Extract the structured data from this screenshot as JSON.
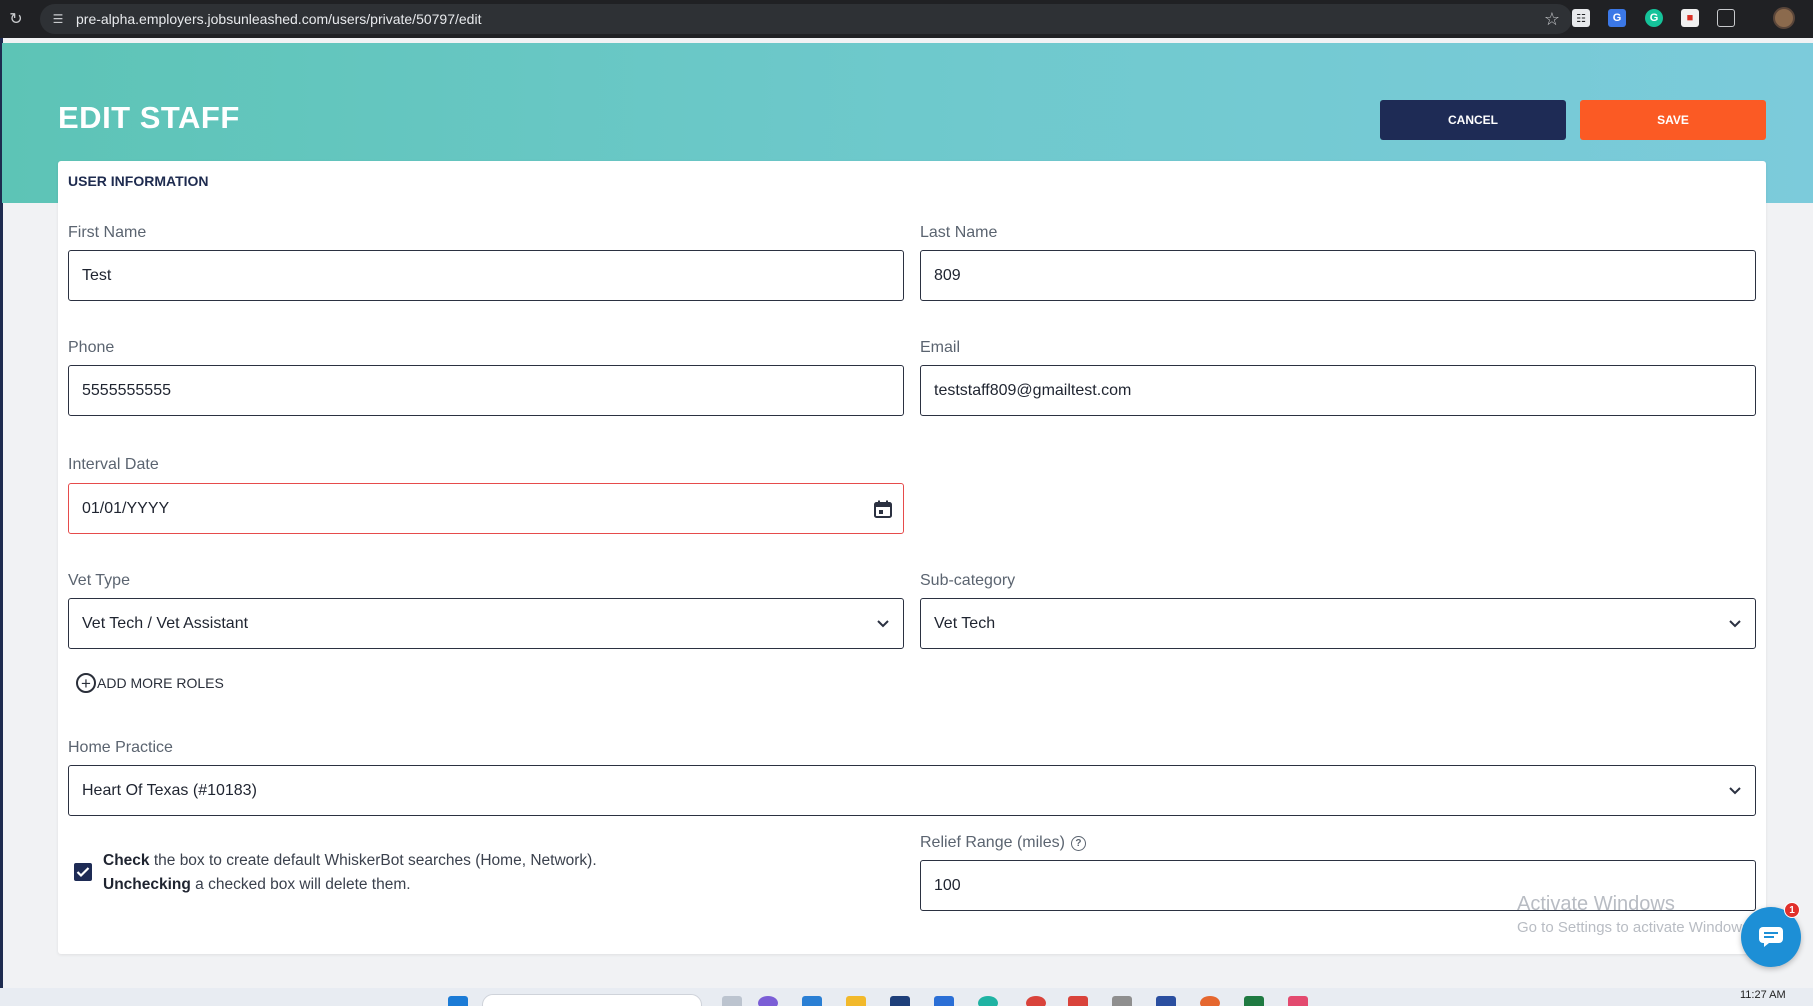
{
  "browser": {
    "url": "pre-alpha.employers.jobsunleashed.com/users/private/50797/edit"
  },
  "page": {
    "title": "EDIT STAFF",
    "cancel_label": "CANCEL",
    "save_label": "SAVE"
  },
  "card": {
    "title": "USER INFORMATION"
  },
  "fields": {
    "first_name": {
      "label": "First Name",
      "value": "Test"
    },
    "last_name": {
      "label": "Last Name",
      "value": "809"
    },
    "phone": {
      "label": "Phone",
      "value": "5555555555"
    },
    "email": {
      "label": "Email",
      "value": "teststaff809@gmailtest.com"
    },
    "interval_date": {
      "label": "Interval Date",
      "value": "01/01/YYYY"
    },
    "vet_type": {
      "label": "Vet Type",
      "value": "Vet Tech / Vet Assistant"
    },
    "sub_category": {
      "label": "Sub-category",
      "value": "Vet Tech"
    },
    "home_practice": {
      "label": "Home Practice",
      "value": "Heart Of Texas (#10183)"
    },
    "relief_range": {
      "label": "Relief Range (miles)",
      "value": "100"
    }
  },
  "add_roles_label": "ADD MORE ROLES",
  "whiskerbot": {
    "checked": true,
    "line1_bold": "Check",
    "line1_rest": " the box to create default WhiskerBot searches (Home, Network).",
    "line2_bold": "Unchecking",
    "line2_rest": " a checked box will delete them."
  },
  "watermark": {
    "title": "Activate Windows",
    "subtitle": "Go to Settings to activate Windows."
  },
  "chat": {
    "badge_count": "1"
  },
  "taskbar": {
    "time": "11:27 AM"
  },
  "colors": {
    "header_gradient_start": "#5dc4b6",
    "header_gradient_end": "#7ccbdb",
    "cancel_button": "#1e2b55",
    "save_button": "#fb5a24",
    "error_border": "#e64b4b",
    "chat_button": "#1d8fd6"
  }
}
